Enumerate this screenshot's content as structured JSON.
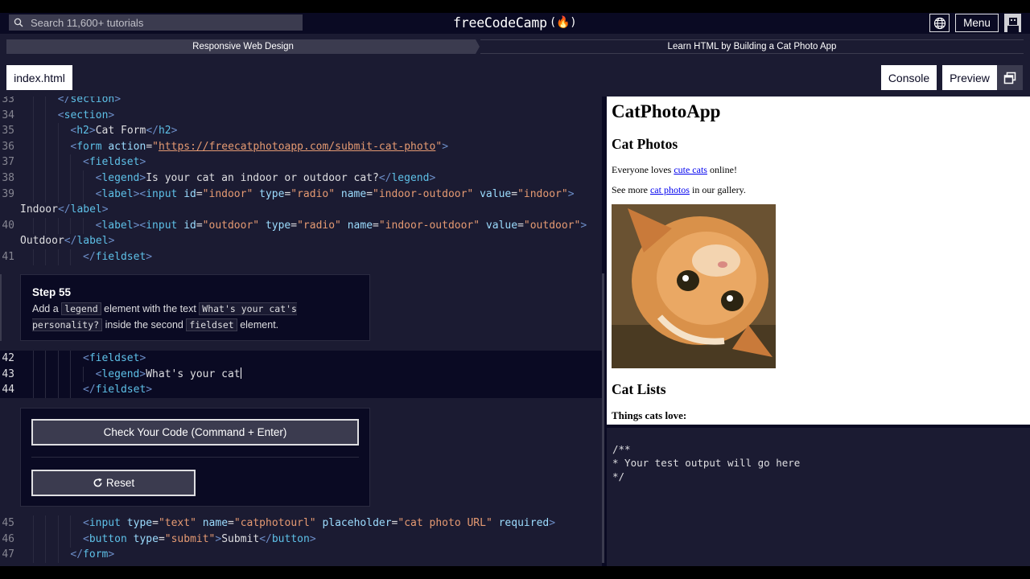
{
  "header": {
    "search_placeholder": "Search 11,600+ tutorials",
    "logo_text": "freeCodeCamp",
    "logo_flame": "(🔥)",
    "menu_label": "Menu"
  },
  "breadcrumb": {
    "superblock": "Responsive Web Design",
    "block": "Learn HTML by Building a Cat Photo App"
  },
  "tabs": {
    "file": "index.html",
    "console": "Console",
    "preview": "Preview"
  },
  "editor": {
    "lines_top": [
      {
        "n": "33",
        "indent": 3,
        "parts": [
          [
            "t-tag",
            "</"
          ],
          [
            "t-name",
            "section"
          ],
          [
            "t-tag",
            ">"
          ]
        ]
      },
      {
        "n": "34",
        "indent": 3,
        "parts": [
          [
            "t-tag",
            "<"
          ],
          [
            "t-name",
            "section"
          ],
          [
            "t-tag",
            ">"
          ]
        ]
      },
      {
        "n": "35",
        "indent": 4,
        "parts": [
          [
            "t-tag",
            "<"
          ],
          [
            "t-name",
            "h2"
          ],
          [
            "t-tag",
            ">"
          ],
          [
            "t-txt",
            "Cat Form"
          ],
          [
            "t-tag",
            "</"
          ],
          [
            "t-name",
            "h2"
          ],
          [
            "t-tag",
            ">"
          ]
        ]
      },
      {
        "n": "36",
        "indent": 4,
        "parts": [
          [
            "t-tag",
            "<"
          ],
          [
            "t-name",
            "form"
          ],
          [
            "t-txt",
            " "
          ],
          [
            "t-attr",
            "action"
          ],
          [
            "t-txt",
            "="
          ],
          [
            "t-str",
            "\""
          ],
          [
            "t-url",
            "https://freecatphotoapp.com/submit-cat-photo"
          ],
          [
            "t-str",
            "\""
          ],
          [
            "t-tag",
            ">"
          ]
        ]
      },
      {
        "n": "37",
        "indent": 5,
        "parts": [
          [
            "t-tag",
            "<"
          ],
          [
            "t-name",
            "fieldset"
          ],
          [
            "t-tag",
            ">"
          ]
        ]
      },
      {
        "n": "38",
        "indent": 6,
        "parts": [
          [
            "t-tag",
            "<"
          ],
          [
            "t-name",
            "legend"
          ],
          [
            "t-tag",
            ">"
          ],
          [
            "t-txt",
            "Is your cat an indoor or outdoor cat?"
          ],
          [
            "t-tag",
            "</"
          ],
          [
            "t-name",
            "legend"
          ],
          [
            "t-tag",
            ">"
          ]
        ]
      },
      {
        "n": "39",
        "indent": 6,
        "parts": [
          [
            "t-tag",
            "<"
          ],
          [
            "t-name",
            "label"
          ],
          [
            "t-tag",
            "><"
          ],
          [
            "t-name",
            "input"
          ],
          [
            "t-txt",
            " "
          ],
          [
            "t-attr",
            "id"
          ],
          [
            "t-txt",
            "="
          ],
          [
            "t-str",
            "\"indoor\""
          ],
          [
            "t-txt",
            " "
          ],
          [
            "t-attr",
            "type"
          ],
          [
            "t-txt",
            "="
          ],
          [
            "t-str",
            "\"radio\""
          ],
          [
            "t-txt",
            " "
          ],
          [
            "t-attr",
            "name"
          ],
          [
            "t-txt",
            "="
          ],
          [
            "t-str",
            "\"indoor-outdoor\""
          ],
          [
            "t-txt",
            " "
          ],
          [
            "t-attr",
            "value"
          ],
          [
            "t-txt",
            "="
          ],
          [
            "t-str",
            "\"indoor\""
          ],
          [
            "t-tag",
            ">"
          ]
        ]
      },
      {
        "n": "",
        "indent": 0,
        "parts": [
          [
            "t-txt",
            "Indoor"
          ],
          [
            "t-tag",
            "</"
          ],
          [
            "t-name",
            "label"
          ],
          [
            "t-tag",
            ">"
          ]
        ]
      },
      {
        "n": "40",
        "indent": 6,
        "parts": [
          [
            "t-tag",
            "<"
          ],
          [
            "t-name",
            "label"
          ],
          [
            "t-tag",
            "><"
          ],
          [
            "t-name",
            "input"
          ],
          [
            "t-txt",
            " "
          ],
          [
            "t-attr",
            "id"
          ],
          [
            "t-txt",
            "="
          ],
          [
            "t-str",
            "\"outdoor\""
          ],
          [
            "t-txt",
            " "
          ],
          [
            "t-attr",
            "type"
          ],
          [
            "t-txt",
            "="
          ],
          [
            "t-str",
            "\"radio\""
          ],
          [
            "t-txt",
            " "
          ],
          [
            "t-attr",
            "name"
          ],
          [
            "t-txt",
            "="
          ],
          [
            "t-str",
            "\"indoor-outdoor\""
          ],
          [
            "t-txt",
            " "
          ],
          [
            "t-attr",
            "value"
          ],
          [
            "t-txt",
            "="
          ],
          [
            "t-str",
            "\"outdoor\""
          ],
          [
            "t-tag",
            ">"
          ]
        ]
      },
      {
        "n": "",
        "indent": 0,
        "parts": [
          [
            "t-txt",
            "Outdoor"
          ],
          [
            "t-tag",
            "</"
          ],
          [
            "t-name",
            "label"
          ],
          [
            "t-tag",
            ">"
          ]
        ]
      },
      {
        "n": "41",
        "indent": 5,
        "parts": [
          [
            "t-tag",
            "</"
          ],
          [
            "t-name",
            "fieldset"
          ],
          [
            "t-tag",
            ">"
          ]
        ]
      }
    ],
    "lines_mid": [
      {
        "n": "42",
        "indent": 5,
        "parts": [
          [
            "t-tag",
            "<"
          ],
          [
            "t-name",
            "fieldset"
          ],
          [
            "t-tag",
            ">"
          ]
        ]
      },
      {
        "n": "43",
        "indent": 6,
        "parts": [
          [
            "t-tag",
            "<"
          ],
          [
            "t-name",
            "legend"
          ],
          [
            "t-tag",
            ">"
          ],
          [
            "t-txt",
            "What's your cat"
          ]
        ],
        "cursor": true
      },
      {
        "n": "44",
        "indent": 5,
        "parts": [
          [
            "t-tag",
            "</"
          ],
          [
            "t-name",
            "fieldset"
          ],
          [
            "t-tag",
            ">"
          ]
        ]
      }
    ],
    "lines_bottom": [
      {
        "n": "45",
        "indent": 5,
        "parts": [
          [
            "t-tag",
            "<"
          ],
          [
            "t-name",
            "input"
          ],
          [
            "t-txt",
            " "
          ],
          [
            "t-attr",
            "type"
          ],
          [
            "t-txt",
            "="
          ],
          [
            "t-str",
            "\"text\""
          ],
          [
            "t-txt",
            " "
          ],
          [
            "t-attr",
            "name"
          ],
          [
            "t-txt",
            "="
          ],
          [
            "t-str",
            "\"catphotourl\""
          ],
          [
            "t-txt",
            " "
          ],
          [
            "t-attr",
            "placeholder"
          ],
          [
            "t-txt",
            "="
          ],
          [
            "t-str",
            "\"cat photo URL\""
          ],
          [
            "t-txt",
            " "
          ],
          [
            "t-attr",
            "required"
          ],
          [
            "t-tag",
            ">"
          ]
        ]
      },
      {
        "n": "46",
        "indent": 5,
        "parts": [
          [
            "t-tag",
            "<"
          ],
          [
            "t-name",
            "button"
          ],
          [
            "t-txt",
            " "
          ],
          [
            "t-attr",
            "type"
          ],
          [
            "t-txt",
            "="
          ],
          [
            "t-str",
            "\"submit\""
          ],
          [
            "t-tag",
            ">"
          ],
          [
            "t-txt",
            "Submit"
          ],
          [
            "t-tag",
            "</"
          ],
          [
            "t-name",
            "button"
          ],
          [
            "t-tag",
            ">"
          ]
        ]
      },
      {
        "n": "47",
        "indent": 4,
        "parts": [
          [
            "t-tag",
            "</"
          ],
          [
            "t-name",
            "form"
          ],
          [
            "t-tag",
            ">"
          ]
        ]
      }
    ]
  },
  "step": {
    "title": "Step 55",
    "t1": "Add a ",
    "c1": "legend",
    "t2": " element with the text ",
    "c2": "What's your cat's personality?",
    "t3": " inside the second ",
    "c3": "fieldset",
    "t4": " element."
  },
  "actions": {
    "check_label": "Check Your Code (Command + Enter)",
    "reset_label": "Reset"
  },
  "preview": {
    "h1": "CatPhotoApp",
    "h2_photos": "Cat Photos",
    "p1_before": "Everyone loves ",
    "p1_link": "cute cats",
    "p1_after": " online!",
    "p2_before": "See more ",
    "p2_link": "cat photos",
    "p2_after": " in our gallery.",
    "h2_lists": "Cat Lists",
    "h3_things": "Things cats love:"
  },
  "console": {
    "text": "/**\n* Your test output will go here\n*/"
  },
  "colors": {
    "bg_dark": "#0a0a23",
    "bg_mid": "#1b1b32",
    "gray": "#3b3b4f",
    "tag": "#6c8dc7",
    "string": "#e59a72"
  }
}
